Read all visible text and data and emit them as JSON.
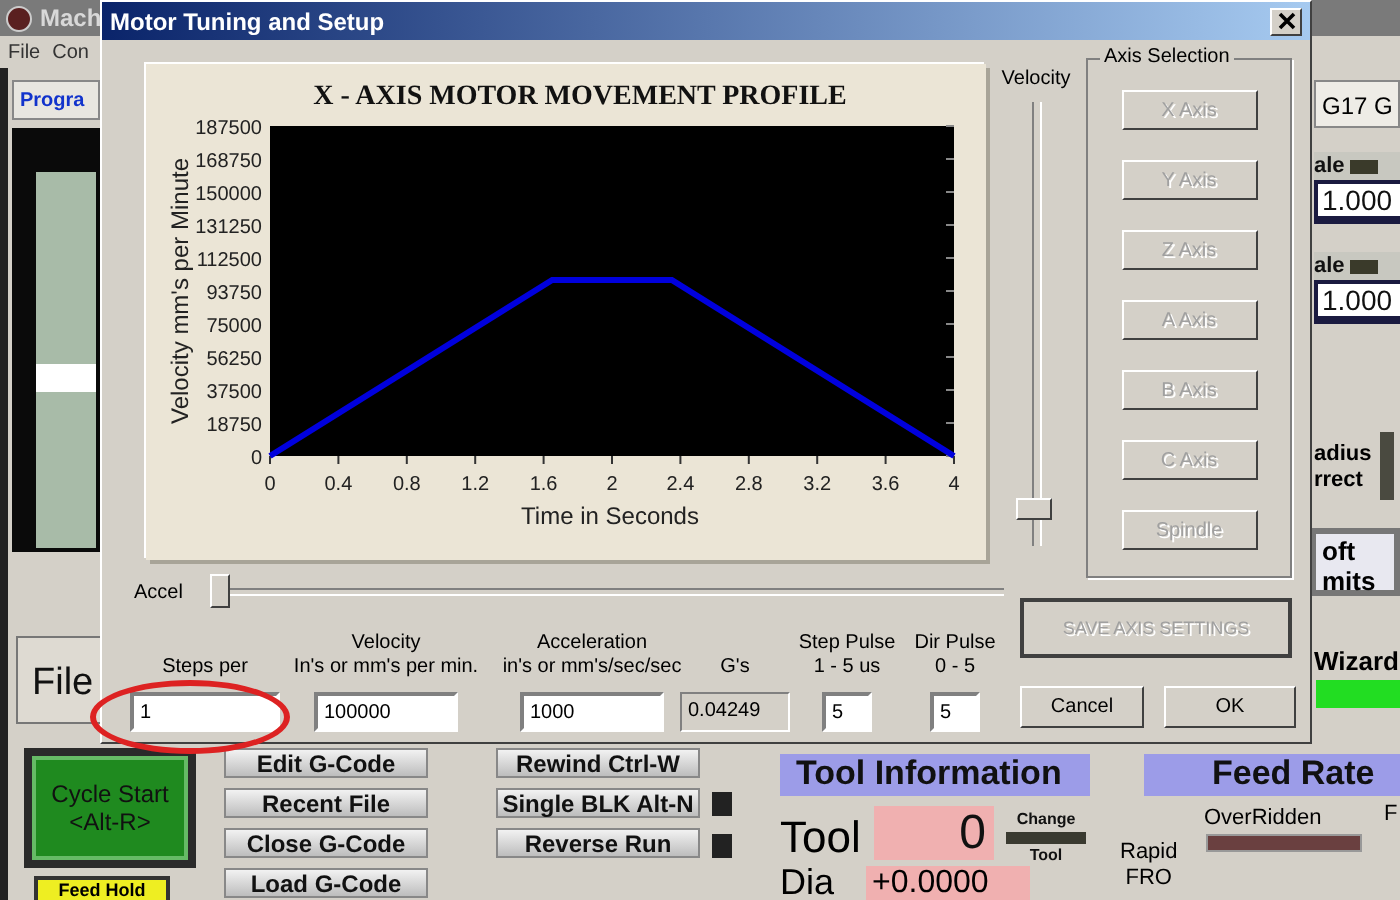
{
  "app": {
    "title": "Mach",
    "menu": [
      "File",
      "Con"
    ],
    "tab": "Progra",
    "file_tab": "File",
    "mode_display": "G17 G",
    "scales": [
      {
        "label": "ale",
        "value": "1.000"
      },
      {
        "label": "ale",
        "value": "1.000"
      }
    ],
    "radius_label": "adius\nrrect",
    "limits_button": "oft\nmits",
    "wizard_label": "Wizard",
    "cycle_start": "Cycle Start\n<Alt-R>",
    "feed_hold": "Feed Hold",
    "file_buttons": [
      "Edit G-Code",
      "Recent File",
      "Close G-Code",
      "Load G-Code"
    ],
    "run_buttons": [
      "Rewind Ctrl-W",
      "Single BLK Alt-N",
      "Reverse Run"
    ],
    "tool_info": {
      "title": "Tool Information",
      "tool_label": "Tool",
      "tool_value": "0",
      "change_tool": [
        "Change",
        "Tool"
      ],
      "dia_label": "Dia",
      "dia_value": "+0.0000"
    },
    "feed_rate": {
      "title": "Feed Rate",
      "overridden": "OverRidden",
      "rapid_fro": "Rapid\nFRO",
      "cut_label": "F"
    }
  },
  "dialog": {
    "title": "Motor Tuning and Setup",
    "chart_data": {
      "type": "line",
      "title": "X - AXIS MOTOR MOVEMENT PROFILE",
      "xlabel": "Time in Seconds",
      "ylabel": "Velocity mm's per Minute",
      "x": [
        0,
        1.65,
        2.35,
        4
      ],
      "series": [
        {
          "color": "#0000dd",
          "values": [
            0,
            100000,
            100000,
            0
          ]
        }
      ],
      "xlim": [
        0,
        4
      ],
      "ylim": [
        0,
        187500
      ],
      "xticks": [
        0,
        0.4,
        0.8,
        1.2,
        1.6,
        2,
        2.4,
        2.8,
        3.2,
        3.6,
        4
      ],
      "yticks": [
        0,
        18750,
        37500,
        56250,
        75000,
        93750,
        112500,
        131250,
        150000,
        168750,
        187500
      ]
    },
    "velocity_slider": {
      "label": "Velocity",
      "level": 0.06
    },
    "axis_selection": {
      "title": "Axis Selection",
      "buttons": [
        {
          "label": "X Axis",
          "disabled": true
        },
        {
          "label": "Y Axis",
          "disabled": true
        },
        {
          "label": "Z Axis",
          "disabled": true
        },
        {
          "label": "A Axis",
          "disabled": true
        },
        {
          "label": "B Axis",
          "disabled": true
        },
        {
          "label": "C Axis",
          "disabled": true
        },
        {
          "label": "Spindle",
          "disabled": true
        }
      ]
    },
    "accel_slider": {
      "label": "Accel",
      "level": 0
    },
    "fields": [
      {
        "label": "Steps per",
        "value": "1",
        "kind": "input",
        "circled": true
      },
      {
        "label": "Velocity\nIn's or mm's per min.",
        "value": "100000",
        "kind": "input",
        "circled": false
      },
      {
        "label": "Acceleration\nin's or mm's/sec/sec",
        "value": "1000",
        "kind": "input",
        "circled": false
      },
      {
        "label": "G's",
        "value": "0.04249",
        "kind": "readout",
        "circled": false
      },
      {
        "label": "Step Pulse\n1 - 5 us",
        "value": "5",
        "kind": "input",
        "circled": false
      },
      {
        "label": "Dir Pulse\n0 - 5",
        "value": "5",
        "kind": "input",
        "circled": false
      }
    ],
    "buttons": [
      {
        "label": "SAVE AXIS SETTINGS",
        "disabled": true
      },
      {
        "label": "Cancel",
        "disabled": false
      },
      {
        "label": "OK",
        "disabled": false
      }
    ]
  }
}
